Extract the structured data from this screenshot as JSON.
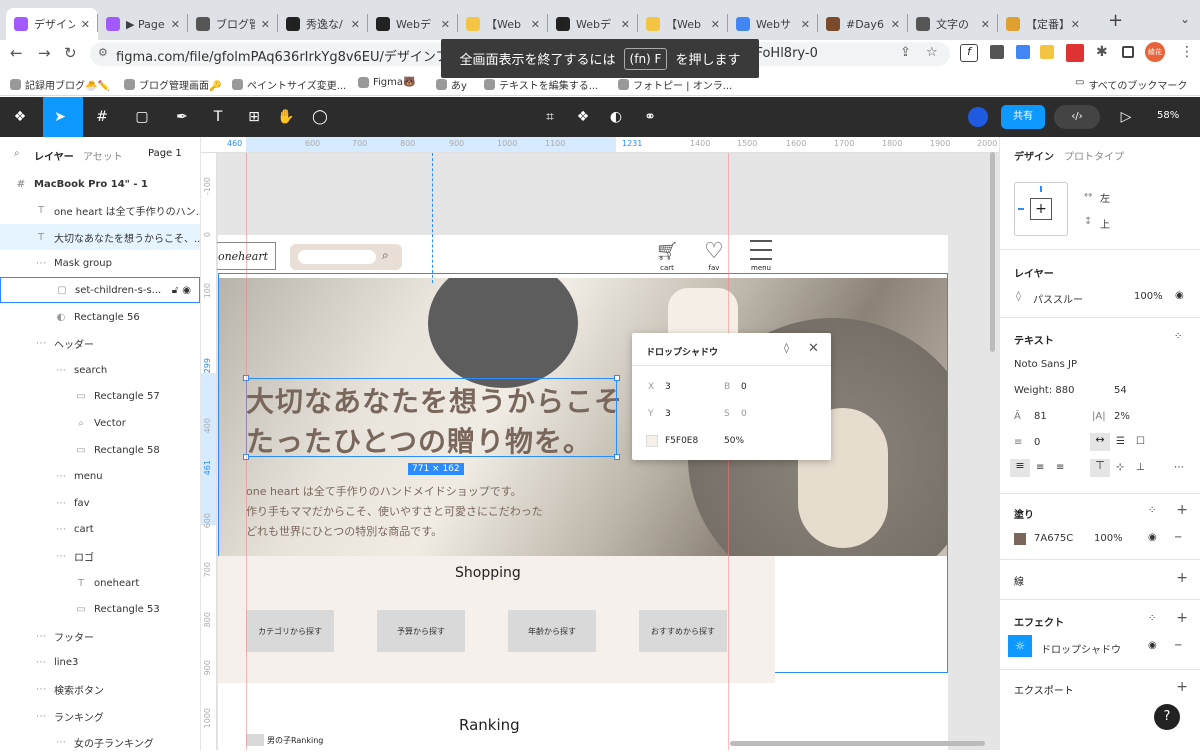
{
  "browser": {
    "tabs": [
      {
        "label": "デザイン",
        "active": true,
        "color": "#a259ff"
      },
      {
        "label": "▶ Page",
        "color": "#a259ff"
      },
      {
        "label": "ブログ管",
        "color": "#555"
      },
      {
        "label": "秀逸な/",
        "color": "#222"
      },
      {
        "label": "Webデ",
        "color": "#222"
      },
      {
        "label": "【Web",
        "color": "#f4c542"
      },
      {
        "label": "Webデ",
        "color": "#222"
      },
      {
        "label": "【Web",
        "color": "#f4c542"
      },
      {
        "label": "Webサ",
        "color": "#4285f4"
      },
      {
        "label": "#Day6",
        "color": "#7a4a2a"
      },
      {
        "label": "文字の",
        "color": "#555"
      },
      {
        "label": "【定番】",
        "color": "#e0a030"
      }
    ],
    "url": "figma.com/file/gfolmPAq636rIrkYg8v6EU/デザインファイル?type=",
    "url_tail": "X55FoHl8ry-0",
    "fullscreen_notice_pre": "全画面表示を終了するには",
    "fullscreen_notice_key": "(fn) F",
    "fullscreen_notice_post": "を押します",
    "profile": "綾花",
    "bookmarks": [
      "記録用ブログ🐣✏️",
      "ブログ管理画面🔑",
      "ペイントサイズ変更...",
      "Figma🐻",
      "あy",
      "テキストを編集する...",
      "フォトピー | オンラ..."
    ],
    "all_bookmarks": "すべてのブックマーク"
  },
  "toolbar": {
    "share": "共有",
    "zoom": "58%"
  },
  "left": {
    "tab_layers": "レイヤー",
    "tab_assets": "アセット",
    "page": "Page 1",
    "layers": [
      {
        "icon": "#",
        "label": "MacBook Pro 14\" - 1",
        "indent": 0,
        "bold": true
      },
      {
        "icon": "T",
        "label": "one heart は全て手作りのハン...",
        "indent": 1
      },
      {
        "icon": "T",
        "label": "大切なあなたを想うからこそ、...",
        "indent": 1,
        "selected": true
      },
      {
        "icon": "⋯",
        "label": "Mask group",
        "indent": 1
      },
      {
        "icon": "▢",
        "label": "set-children-s-s...",
        "indent": 2,
        "hover": true
      },
      {
        "icon": "◐",
        "label": "Rectangle 56",
        "indent": 2
      },
      {
        "icon": "⋯",
        "label": "ヘッダー",
        "indent": 1
      },
      {
        "icon": "⋯",
        "label": "search",
        "indent": 2
      },
      {
        "icon": "▭",
        "label": "Rectangle 57",
        "indent": 3
      },
      {
        "icon": "⌕",
        "label": "Vector",
        "indent": 3
      },
      {
        "icon": "▭",
        "label": "Rectangle 58",
        "indent": 3
      },
      {
        "icon": "⋯",
        "label": "menu",
        "indent": 2
      },
      {
        "icon": "⋯",
        "label": "fav",
        "indent": 2
      },
      {
        "icon": "⋯",
        "label": "cart",
        "indent": 2
      },
      {
        "icon": "⋯",
        "label": "ロゴ",
        "indent": 2
      },
      {
        "icon": "T",
        "label": "oneheart",
        "indent": 3
      },
      {
        "icon": "▭",
        "label": "Rectangle 53",
        "indent": 3
      },
      {
        "icon": "⋯",
        "label": "フッター",
        "indent": 1
      },
      {
        "icon": "⋯",
        "label": "line3",
        "indent": 1
      },
      {
        "icon": "⋯",
        "label": "検索ボタン",
        "indent": 1
      },
      {
        "icon": "⋯",
        "label": "ランキング",
        "indent": 1
      },
      {
        "icon": "⋯",
        "label": "女の子ランキング",
        "indent": 2
      }
    ]
  },
  "ruler": {
    "top": [
      "460",
      "600",
      "700",
      "800",
      "900",
      "1000",
      "1100",
      "1231",
      "1400",
      "1500",
      "1600",
      "1700",
      "1800",
      "1900",
      "2000"
    ],
    "left": [
      "-100",
      "0",
      "100",
      "299",
      "400",
      "461",
      "600",
      "700",
      "800",
      "900",
      "1000"
    ]
  },
  "design": {
    "logo": "oneheart",
    "cart": "cart",
    "fav": "fav",
    "menu": "menu",
    "headline1": "大切なあなたを想うからこそ",
    "headline2": "たったひとつの贈り物を。",
    "size_badge": "771 × 162",
    "body1": "one heart は全て手作りのハンドメイドショップです。",
    "body2": "作り手もママだからこそ、使いやすさと可愛さにこだわった",
    "body3": "どれも世界にひとつの特別な商品です。",
    "shopping": "Shopping",
    "categories": [
      "カテゴリから探す",
      "予算から探す",
      "年齢から探す",
      "おすすめから探す"
    ],
    "ranking": "Ranking",
    "ranking_tag": "男の子Ranking"
  },
  "shadow_popup": {
    "title": "ドロップシャドウ",
    "x_label": "X",
    "x": "3",
    "b_label": "B",
    "b": "0",
    "y_label": "Y",
    "y": "3",
    "s_label": "S",
    "s": "0",
    "color": "F5F0E8",
    "opacity": "50%"
  },
  "right": {
    "tab_design": "デザイン",
    "tab_proto": "プロトタイプ",
    "constraint_h": "左",
    "constraint_v": "上",
    "layer_title": "レイヤー",
    "blend": "パススルー",
    "layer_opacity": "100%",
    "text_title": "テキスト",
    "font": "Noto Sans JP",
    "weight": "Weight: 880",
    "font_size": "54",
    "line_height": "81",
    "letter_spacing": "2%",
    "para_spacing": "0",
    "fill_title": "塗り",
    "fill_color": "7A675C",
    "fill_opacity": "100%",
    "stroke_title": "線",
    "effect_title": "エフェクト",
    "effect_name": "ドロップシャドウ",
    "export_title": "エクスポート"
  }
}
